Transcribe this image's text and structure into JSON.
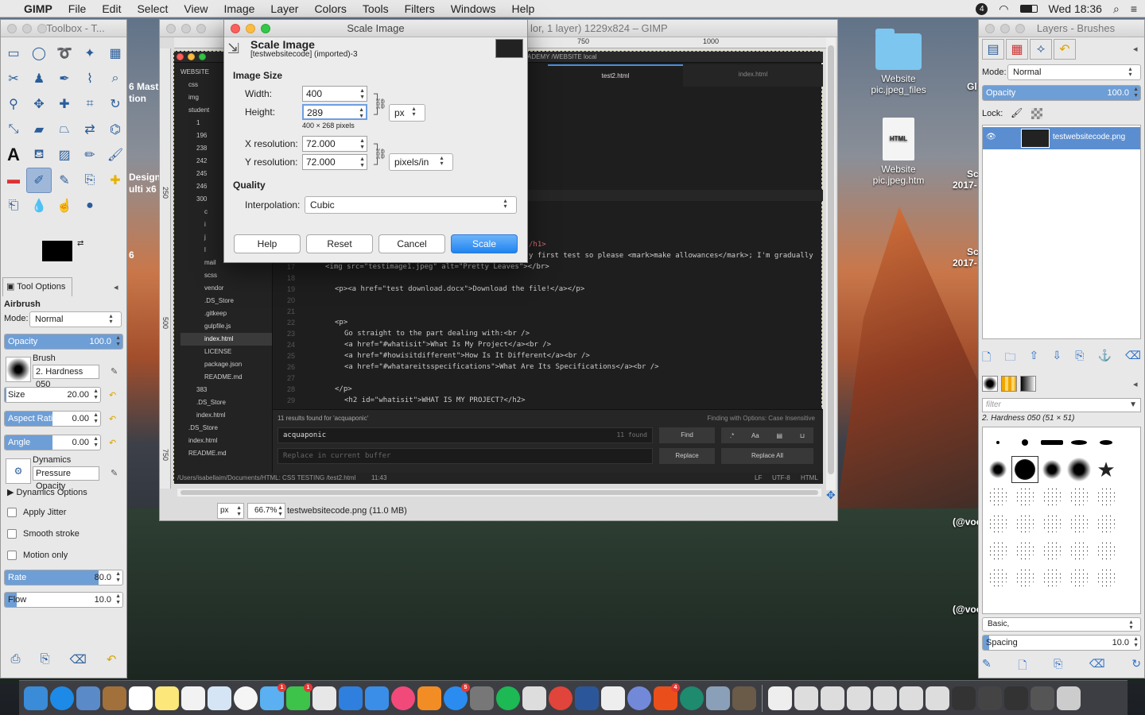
{
  "menubar": {
    "app": "GIMP",
    "items": [
      "File",
      "Edit",
      "Select",
      "View",
      "Image",
      "Layer",
      "Colors",
      "Tools",
      "Filters",
      "Windows",
      "Help"
    ],
    "clock": "Wed 18:36",
    "badge": "4"
  },
  "desktop": {
    "icons": [
      "Website pic.jpeg_files",
      "Website pic.jpeg.htm"
    ],
    "doc_badge": "HTML",
    "fragments": [
      "6 Mast",
      "tion",
      "Design",
      "ulti x6",
      "6",
      "Gl",
      "Sc",
      "2017-",
      "Sc",
      "2017-",
      "(@voc",
      "(@voc"
    ]
  },
  "toolbox": {
    "title": "Toolbox - T...",
    "tab": "Tool Options",
    "tool_name": "Airbrush",
    "mode_label": "Mode:",
    "mode": "Normal",
    "opacity_label": "Opacity",
    "opacity": "100.0",
    "brush_label": "Brush",
    "brush": "2. Hardness 050",
    "sliders": [
      {
        "label": "Size",
        "value": "20.00",
        "level": 0.02
      },
      {
        "label": "Aspect Ratio",
        "value": "0.00",
        "level": 0.5
      },
      {
        "label": "Angle",
        "value": "0.00",
        "level": 0.5
      }
    ],
    "dynamics_label": "Dynamics",
    "dynamics": "Pressure Opacity",
    "dynamics_options": "Dynamics Options",
    "checks": [
      "Apply Jitter",
      "Smooth stroke",
      "Motion only"
    ],
    "rate_label": "Rate",
    "rate": "80.0",
    "rate_level": 0.8,
    "flow_label": "Flow",
    "flow": "10.0",
    "flow_level": 0.1
  },
  "image_window": {
    "title": "lor, 1 layer) 1229x824 – GIMP",
    "ruler_top": [
      "750",
      "1000"
    ],
    "ruler_left": [
      "250",
      "500",
      "750"
    ],
    "unit": "px",
    "zoom": "66.7%",
    "status": "testwebsitecode.png (11.0 MB)"
  },
  "editor": {
    "tabs": [
      "ADEMY /WEBSITE local",
      "test2.html",
      "index.html"
    ],
    "tree": [
      "WEBSITE",
      "css",
      "img",
      "student",
      "1",
      "196",
      "238",
      "242",
      "245",
      "246",
      "300",
      "c",
      "i",
      "j",
      "l",
      "mail",
      "scss",
      "vendor",
      ".DS_Store",
      ".gitkeep",
      "gulpfile.js",
      "index.html",
      "LICENSE",
      "package.json",
      "README.md",
      "383",
      ".DS_Store",
      "index.html",
      ".DS_Store",
      "index.html",
      "README.md"
    ],
    "line_numbers": [
      "17",
      "18",
      "19",
      "20",
      "21",
      "22",
      "23",
      "24",
      "25",
      "26",
      "27",
      "28",
      "29"
    ],
    "code": [
      "/h1>",
      "y first test so please <mark>make allowances</mark>; I'm gradually",
      "<img src=\"testimage1.jpeg\" alt=\"Pretty Leaves\"></br>",
      "<p><a href=\"test download.docx\">Download the file!</a></p>",
      "<p>",
      "Go straight to the part dealing with:<br />",
      "<a href=\"#whatisit\">What Is My Project</a><br />",
      "<a href=\"#howisitdifferent\">How Is It Different</a><br />",
      "<a href=\"#whatareitsspecifications\">What Are Its Specifications</a><br />",
      "</p>",
      "<h2 id=\"whatisit\">WHAT IS MY PROJECT?</h2>"
    ],
    "find_summary": "11 results found for 'acquaponic'",
    "find_options": "Finding with Options: Case Insensitive",
    "search": "acquaponic",
    "found": "11 found",
    "find_btn": "Find",
    "replace_placeholder": "Replace in current buffer",
    "replace_btn": "Replace",
    "replace_all_btn": "Replace All",
    "status_path": "/Users/isabellaim/Documents/HTML: CSS TESTING /test2.html",
    "status_pos": "11:43",
    "status_lf": "LF",
    "status_enc": "UTF-8",
    "status_lang": "HTML",
    "case_opt": "Aa"
  },
  "dialog": {
    "window_title": "Scale Image",
    "heading": "Scale Image",
    "sub": "[testwebsitecode] (imported)-3",
    "image_size": "Image Size",
    "width_label": "Width:",
    "width": "400",
    "height_label": "Height:",
    "height": "289",
    "pixels": "400 × 268 pixels",
    "unit": "px",
    "xres_label": "X resolution:",
    "xres": "72.000",
    "yres_label": "Y resolution:",
    "yres": "72.000",
    "res_unit": "pixels/in",
    "quality": "Quality",
    "interp_label": "Interpolation:",
    "interp": "Cubic",
    "help": "Help",
    "reset": "Reset",
    "cancel": "Cancel",
    "scale": "Scale"
  },
  "layers": {
    "title": "Layers - Brushes",
    "mode_label": "Mode:",
    "mode": "Normal",
    "opacity_label": "Opacity",
    "opacity": "100.0",
    "lock_label": "Lock:",
    "layer_name": "testwebsitecode.png",
    "filter_placeholder": "filter",
    "brush_name": "2. Hardness 050 (51 × 51)",
    "preset": "Basic,",
    "spacing_label": "Spacing",
    "spacing": "10.0"
  },
  "dock": {
    "badges": [
      "1",
      "1",
      "5",
      "4"
    ]
  }
}
